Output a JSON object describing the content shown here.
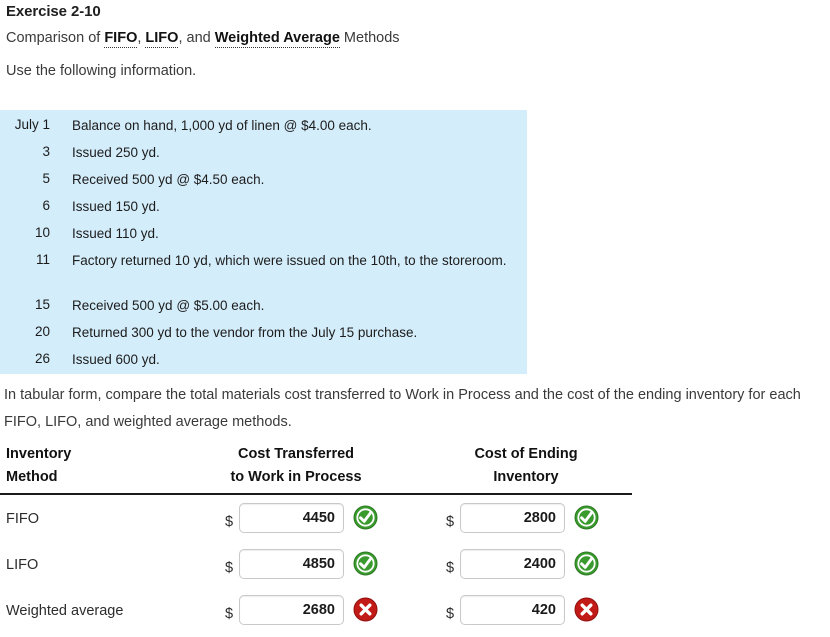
{
  "exercise": {
    "title": "Exercise 2-10",
    "subtitle_prefix": "Comparison of ",
    "term1": "FIFO",
    "sep1": ", ",
    "term2": "LIFO",
    "sep2": ", and ",
    "term3": "Weighted Average",
    "subtitle_suffix": " Methods",
    "use_info": "Use the following information."
  },
  "info_box": {
    "background_color": "#d4edfa",
    "rows": [
      {
        "date": "July 1",
        "description": "Balance on hand, 1,000 yd of linen @ $4.00 each."
      },
      {
        "date": "3",
        "description": "Issued 250 yd."
      },
      {
        "date": "5",
        "description": "Received 500 yd @ $4.50 each."
      },
      {
        "date": "6",
        "description": "Issued 150 yd."
      },
      {
        "date": "10",
        "description": "Issued 110 yd."
      },
      {
        "date": "11",
        "description": "Factory returned 10 yd, which were issued on the 10th, to the storeroom."
      },
      {
        "date": "15",
        "description": "Received 500 yd @ $5.00 each."
      },
      {
        "date": "20",
        "description": "Returned 300 yd to the vendor from the July 15 purchase."
      },
      {
        "date": "26",
        "description": "Issued 600 yd."
      }
    ]
  },
  "instructions": "In tabular form, compare the total materials cost transferred to Work in Process and the cost of the ending inventory for each FIFO, LIFO, and weighted average methods.",
  "table": {
    "headers": {
      "method_line1": "Inventory",
      "method_line2": "Method",
      "transferred_line1": "Cost Transferred",
      "transferred_line2": "to Work in Process",
      "ending_line1": "Cost of Ending",
      "ending_line2": "Inventory"
    },
    "currency_symbol": "$",
    "rows": [
      {
        "label": "FIFO",
        "transferred_value": "4450",
        "transferred_status": "correct",
        "ending_value": "2800",
        "ending_status": "correct"
      },
      {
        "label": "LIFO",
        "transferred_value": "4850",
        "transferred_status": "correct",
        "ending_value": "2400",
        "ending_status": "correct"
      },
      {
        "label": "Weighted average",
        "transferred_value": "2680",
        "transferred_status": "incorrect",
        "ending_value": "420",
        "ending_status": "incorrect"
      }
    ]
  },
  "status_colors": {
    "correct": "#3a9a2e",
    "incorrect": "#c21b17"
  }
}
